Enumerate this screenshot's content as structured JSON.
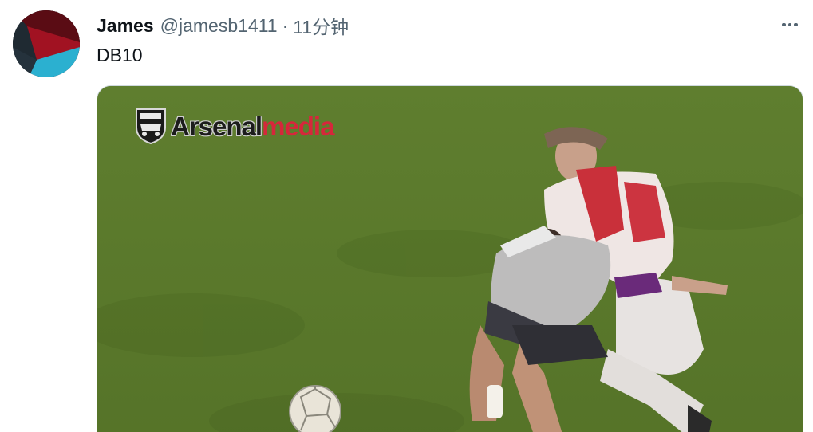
{
  "tweet": {
    "author_name": "James",
    "handle": "@jamesb1411",
    "separator": "·",
    "time": "11分钟",
    "text": "DB10"
  },
  "media": {
    "watermark": {
      "part1": "Arsenal",
      "part2": "media"
    }
  },
  "icons": {
    "avatar": "avatar-image",
    "more": "more-horizontal-icon",
    "club_crest": "arsenal-crest-icon"
  },
  "colors": {
    "name": "#0f1419",
    "secondary": "#536471",
    "pitch": "#5f7d2e",
    "watermark_red": "#d6273b"
  }
}
